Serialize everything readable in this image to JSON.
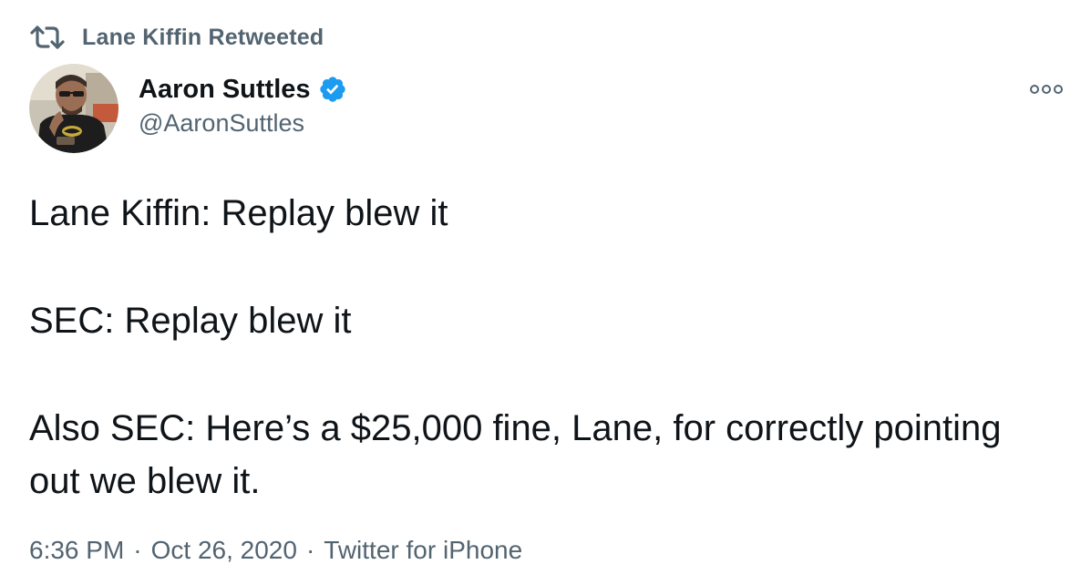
{
  "retweet_context": {
    "label": "Lane Kiffin Retweeted"
  },
  "author": {
    "display_name": "Aaron Suttles",
    "handle": "@AaronSuttles",
    "verified": true,
    "avatar_icon": "profile-photo"
  },
  "tweet": {
    "lines": [
      "Lane Kiffin: Replay blew it",
      "SEC: Replay blew it",
      "Also SEC: Here’s a $25,000 fine, Lane, for correctly pointing out we blew it."
    ]
  },
  "meta": {
    "time": "6:36 PM",
    "separator": "·",
    "date": "Oct 26, 2020",
    "source": "Twitter for iPhone"
  },
  "colors": {
    "text_primary": "#0f1419",
    "text_secondary": "#536471",
    "verified_blue": "#1d9bf0",
    "background": "#ffffff"
  }
}
